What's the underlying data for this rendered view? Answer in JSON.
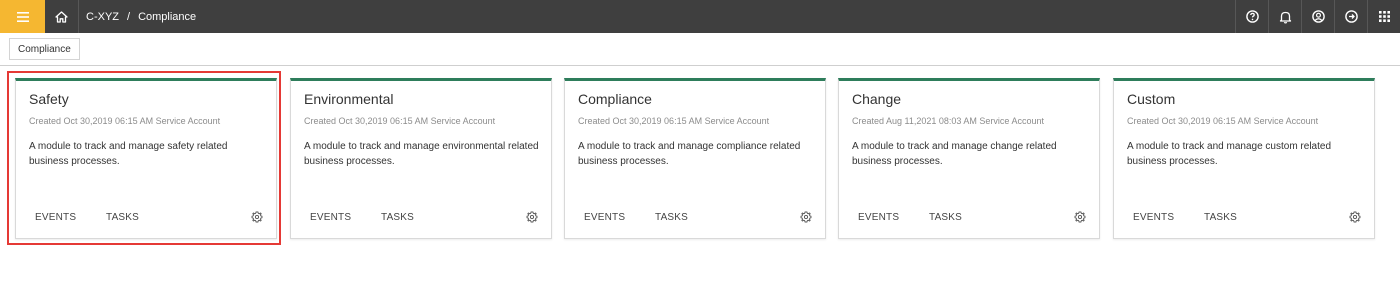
{
  "header": {
    "menu_icon": "hamburger-menu-icon",
    "home_icon": "home-icon",
    "breadcrumb": [
      "C-XYZ",
      "Compliance"
    ],
    "breadcrumb_separator": "/",
    "right_icons": [
      "help-icon",
      "bell-icon",
      "user-icon",
      "logout-icon",
      "apps-grid-icon"
    ],
    "accent_color": "#f5b731",
    "bar_color": "#3f3f3f"
  },
  "tabs": {
    "active_label": "Compliance"
  },
  "card_accent": "#2e7d5b",
  "cards": [
    {
      "title": "Safety",
      "meta": "Created Oct 30,2019 06:15 AM Service Account",
      "description": "A module to track and manage safety related business processes.",
      "events_label": "EVENTS",
      "tasks_label": "TASKS",
      "highlighted": true
    },
    {
      "title": "Environmental",
      "meta": "Created Oct 30,2019 06:15 AM Service Account",
      "description": "A module to track and manage environmental related business processes.",
      "events_label": "EVENTS",
      "tasks_label": "TASKS",
      "highlighted": false
    },
    {
      "title": "Compliance",
      "meta": "Created Oct 30,2019 06:15 AM Service Account",
      "description": "A module to track and manage compliance related business processes.",
      "events_label": "EVENTS",
      "tasks_label": "TASKS",
      "highlighted": false
    },
    {
      "title": "Change",
      "meta": "Created Aug 11,2021 08:03 AM Service Account",
      "description": "A module to track and manage change related business processes.",
      "events_label": "EVENTS",
      "tasks_label": "TASKS",
      "highlighted": false
    },
    {
      "title": "Custom",
      "meta": "Created Oct 30,2019 06:15 AM Service Account",
      "description": "A module to track and manage custom related business processes.",
      "events_label": "EVENTS",
      "tasks_label": "TASKS",
      "highlighted": false
    }
  ]
}
